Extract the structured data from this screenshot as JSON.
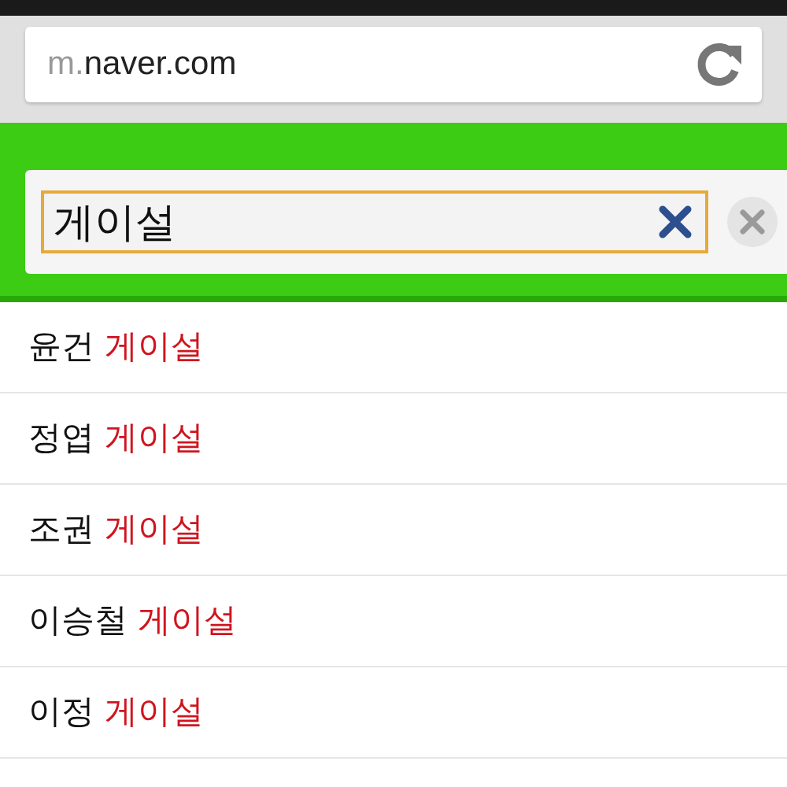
{
  "address_bar": {
    "url_prefix": "m.",
    "url_domain": "naver.com"
  },
  "search": {
    "value": "게이설"
  },
  "suggestions": [
    {
      "prefix": "윤건",
      "match": "게이설"
    },
    {
      "prefix": "정엽",
      "match": "게이설"
    },
    {
      "prefix": "조권",
      "match": "게이설"
    },
    {
      "prefix": "이승철",
      "match": "게이설"
    },
    {
      "prefix": "이정",
      "match": "게이설"
    }
  ]
}
